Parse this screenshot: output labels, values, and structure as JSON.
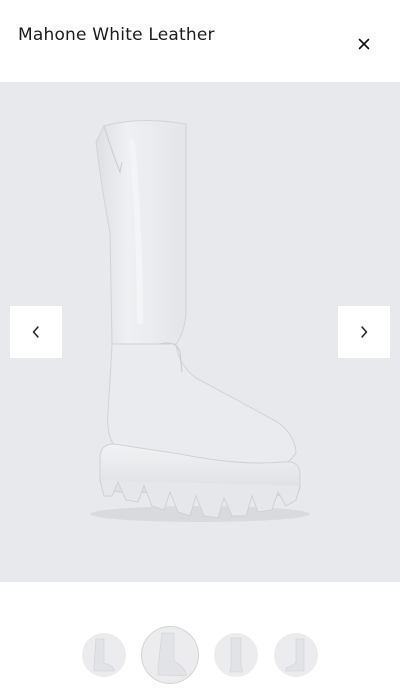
{
  "product": {
    "title": "Mahone White Leather"
  },
  "viewer": {
    "close_icon": "close-icon",
    "prev_icon": "chevron-left-icon",
    "next_icon": "chevron-right-icon",
    "background_color": "#e8e9ec",
    "thumbnails": [
      {
        "view": "side"
      },
      {
        "view": "front-angle",
        "active": true
      },
      {
        "view": "back"
      },
      {
        "view": "inner-side"
      }
    ]
  }
}
